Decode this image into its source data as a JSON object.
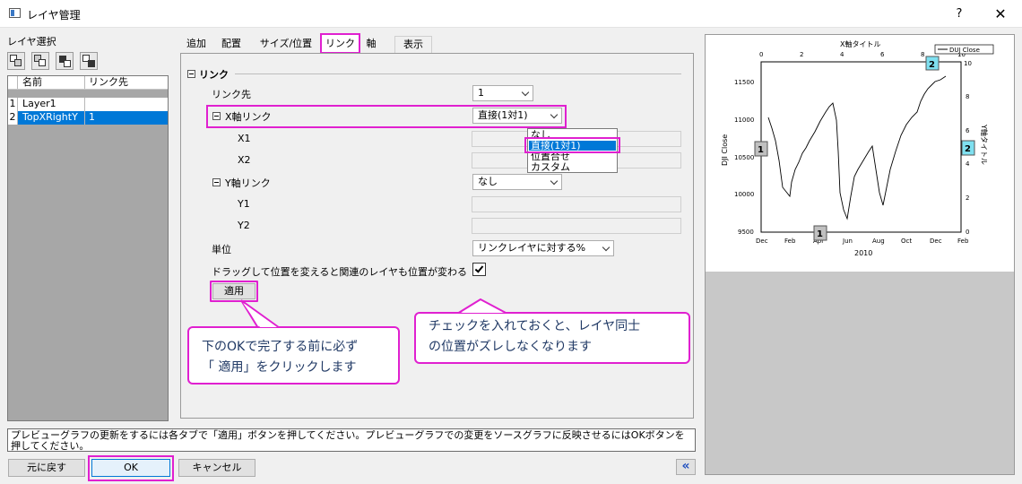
{
  "window": {
    "title": "レイヤ管理",
    "help": "?",
    "close": "✕"
  },
  "left": {
    "label": "レイヤ選択",
    "toolbar_icons": [
      "layer-tool-1-icon",
      "layer-tool-2-icon",
      "layer-tool-3-icon",
      "layer-tool-4-icon"
    ],
    "table": {
      "headers": [
        "名前",
        "リンク先"
      ],
      "rows": [
        {
          "num": "1",
          "name": "Layer1",
          "link": ""
        },
        {
          "num": "2",
          "name": "TopXRightY",
          "link": "1"
        }
      ]
    }
  },
  "tabs": [
    "追加",
    "配置",
    "サイズ/位置",
    "リンク",
    "軸",
    "表示"
  ],
  "active_tab": "リンク",
  "link_panel": {
    "section": "リンク",
    "link_to_label": "リンク先",
    "link_to_value": "1",
    "x_link_label": "X軸リンク",
    "x_link_value": "直接(1対1)",
    "x1_label": "X1",
    "x2_label": "X2",
    "y_link_label": "Y軸リンク",
    "y_link_value": "なし",
    "y1_label": "Y1",
    "y2_label": "Y2",
    "unit_label": "単位",
    "unit_value": "リンクレイヤに対する%",
    "drag_label": "ドラッグして位置を変えると関連のレイヤも位置が変わる",
    "drag_checked": true,
    "apply": "適用",
    "dropdown_options": [
      "なし",
      "直接(1対1)",
      "位置合せ",
      "カスタム"
    ],
    "dropdown_selected": "直接(1対1)"
  },
  "callouts": {
    "apply_line1": "下のOKで完了する前に必ず",
    "apply_line2": "「 適用」をクリックします",
    "check_line1": "チェックを入れておくと、レイヤ同士",
    "check_line2": "の位置がズレしなくなります"
  },
  "preview": {
    "top_title": "X軸タイトル",
    "legend": "DUJ Close",
    "left_ylabel": "DJI Close",
    "right_ylabel": "Y軸タイトル",
    "bottom_xlabel": "2010",
    "left_ticks": [
      "11500",
      "11000",
      "10500",
      "10000",
      "9500"
    ],
    "right_ticks": [
      "10",
      "8",
      "6",
      "4",
      "2",
      "0"
    ],
    "top_ticks": [
      "0",
      "2",
      "4",
      "6",
      "8",
      "10"
    ],
    "bottom_ticks": [
      "Dec",
      "Feb",
      "Apr",
      "Jun",
      "Aug",
      "Oct",
      "Dec",
      "Feb"
    ],
    "layer_badges": [
      "1",
      "1",
      "2",
      "2"
    ]
  },
  "status": "プレビューグラフの更新をするには各タブで「適用」ボタンを押してください。プレビューグラフでの変更をソースグラフに反映させるにはOKボタンを押してください。",
  "buttons": {
    "revert": "元に戻す",
    "ok": "OK",
    "cancel": "キャンセル",
    "collapse": "«"
  },
  "colors": {
    "highlight": "#e020d0",
    "selection": "#0078d7",
    "callout_text": "#1f3864",
    "badge_layer1": "#c0c0c0",
    "badge_layer2": "#7fe0f0"
  }
}
